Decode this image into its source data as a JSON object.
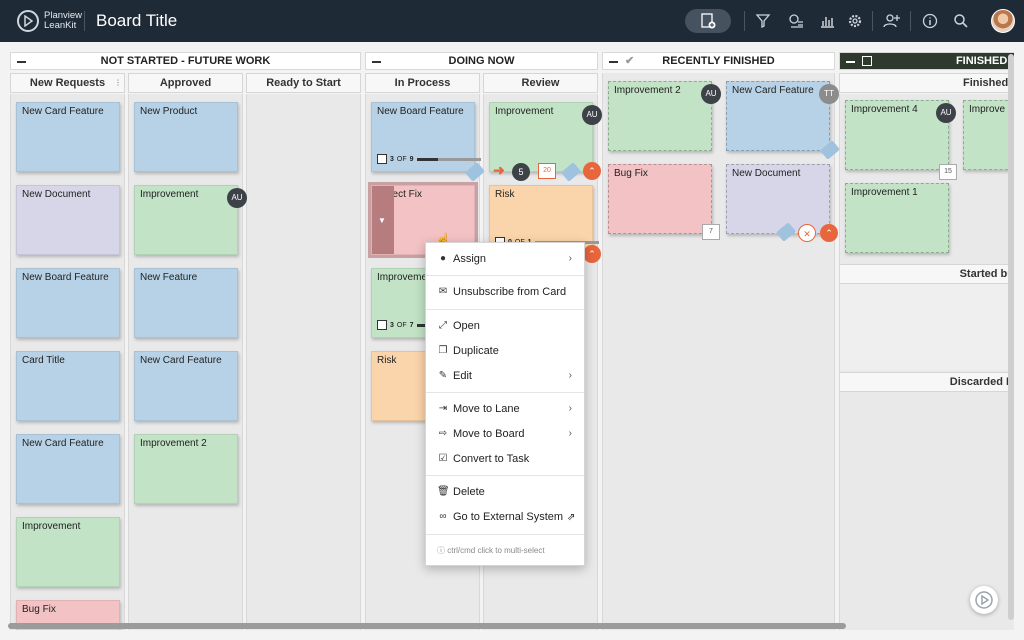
{
  "app": {
    "brand_line1": "Planview",
    "brand_line2": "LeanKit",
    "title": "Board Title"
  },
  "lanes": {
    "not_started": {
      "title": "NOT STARTED - FUTURE WORK",
      "cols": [
        "New Requests",
        "Approved",
        "Ready to Start"
      ]
    },
    "doing": {
      "title": "DOING NOW",
      "cols": [
        "In Process",
        "Review"
      ]
    },
    "recent": {
      "title": "RECENTLY FINISHED"
    },
    "finished": {
      "title": "FINISHED -",
      "col": "Finished",
      "sub1": "Started bu",
      "sub2": "Discarded R"
    }
  },
  "cards": {
    "new_requests": [
      "New Card Feature",
      "New Document",
      "New Board Feature",
      "Card Title",
      "New Card Feature",
      "Improvement",
      "Bug Fix"
    ],
    "approved": [
      "New Product",
      "Improvement",
      "New Feature",
      "New Card Feature",
      "Improvement 2"
    ],
    "in_process": [
      "New Board Feature",
      "Defect Fix",
      "Improvement",
      "Risk"
    ],
    "review": [
      "Improvement",
      "Risk"
    ],
    "recent": [
      "Improvement 2",
      "New Card Feature",
      "Bug Fix",
      "New Document"
    ],
    "finished": [
      "Improvement 4",
      "Improvement 1",
      "Improve"
    ]
  },
  "badges": {
    "au": "AU",
    "tt": "TT"
  },
  "progress": {
    "p1": {
      "done": "3",
      "of": "OF",
      "total": "9",
      "fraction": 0.33
    },
    "p2": {
      "done": "0",
      "of": "OF",
      "total": "1",
      "fraction": 0.0
    },
    "p3": {
      "done": "3",
      "of": "OF",
      "total": "7",
      "fraction": 0.43
    }
  },
  "meta": {
    "count5": "5",
    "cal20": "20",
    "cal7": "7",
    "cal15": "15"
  },
  "menu": {
    "assign": "Assign",
    "unsubscribe": "Unsubscribe from Card",
    "open": "Open",
    "duplicate": "Duplicate",
    "edit": "Edit",
    "move_lane": "Move to Lane",
    "move_board": "Move to Board",
    "convert": "Convert to Task",
    "delete": "Delete",
    "external": "Go to External System",
    "hint": "ctrl/cmd click to multi-select"
  },
  "colors": {
    "topbar": "#1f2a37",
    "blue": "#b7d2e6",
    "green": "#c2e3c6",
    "purple": "#d7d6e8",
    "red": "#f2c2c4",
    "orange": "#fad4ab",
    "accent": "#e8663d"
  }
}
